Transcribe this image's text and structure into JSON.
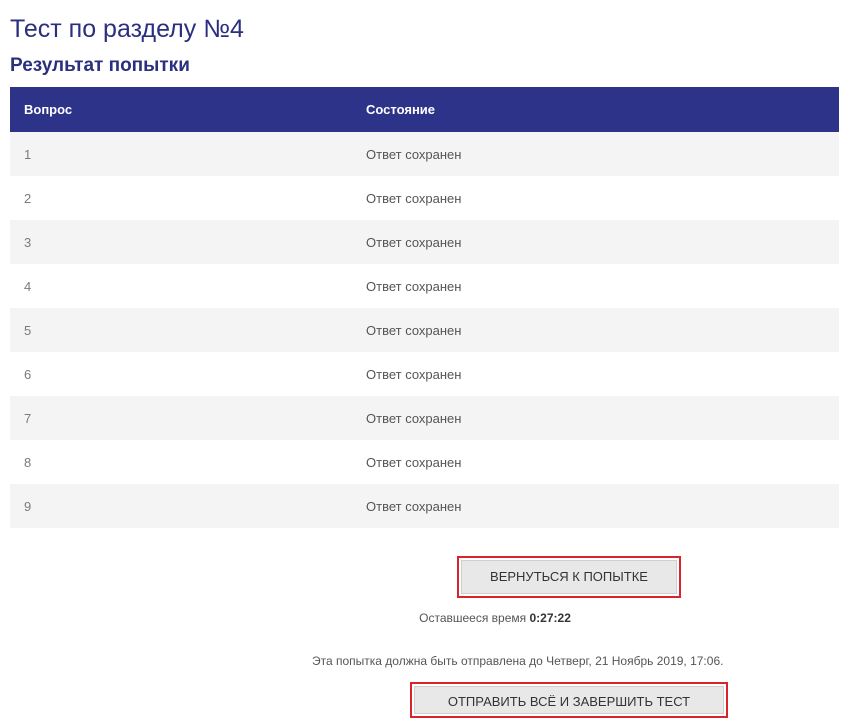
{
  "header": {
    "title": "Тест по разделу №4",
    "subtitle": "Результат попытки"
  },
  "table": {
    "columns": [
      "Вопрос",
      "Состояние"
    ],
    "rows": [
      {
        "question": "1",
        "state": "Ответ сохранен"
      },
      {
        "question": "2",
        "state": "Ответ сохранен"
      },
      {
        "question": "3",
        "state": "Ответ сохранен"
      },
      {
        "question": "4",
        "state": "Ответ сохранен"
      },
      {
        "question": "5",
        "state": "Ответ сохранен"
      },
      {
        "question": "6",
        "state": "Ответ сохранен"
      },
      {
        "question": "7",
        "state": "Ответ сохранен"
      },
      {
        "question": "8",
        "state": "Ответ сохранен"
      },
      {
        "question": "9",
        "state": "Ответ сохранен"
      }
    ]
  },
  "actions": {
    "return_label": "ВЕРНУТЬСЯ К ПОПЫТКЕ",
    "submit_label": "ОТПРАВИТЬ ВСЁ И ЗАВЕРШИТЬ ТЕСТ"
  },
  "timer": {
    "label": "Оставшееся время",
    "value": "0:27:22"
  },
  "deadline": {
    "text": "Эта попытка должна быть отправлена до Четверг, 21 Ноябрь 2019, 17:06."
  },
  "colors": {
    "header_bg": "#2d3389",
    "title_color": "#2a2f7e",
    "highlight_border": "#d9232d"
  }
}
